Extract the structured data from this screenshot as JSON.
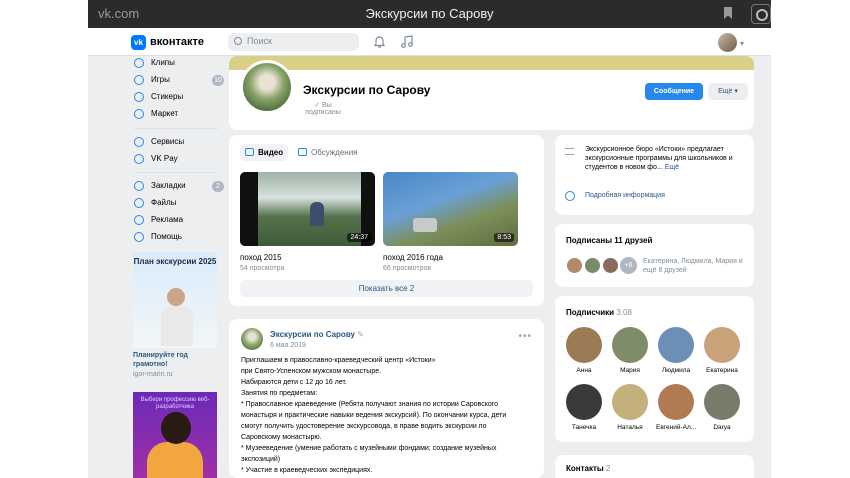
{
  "browser": {
    "url": "vk.com",
    "title": "Экскурсии по Сарову"
  },
  "header": {
    "logo_letters": "vk",
    "logo_text": "вконтакте",
    "search_placeholder": "Поиск"
  },
  "sidebar": {
    "items": [
      {
        "label": "Клипы",
        "icon": "clips-icon"
      },
      {
        "label": "Игры",
        "icon": "games-icon",
        "count": "10"
      },
      {
        "label": "Стикеры",
        "icon": "stickers-icon"
      },
      {
        "label": "Маркет",
        "icon": "market-icon"
      },
      {
        "label": "Сервисы",
        "icon": "services-icon"
      },
      {
        "label": "VK Pay",
        "icon": "vkpay-icon"
      },
      {
        "label": "Закладки",
        "icon": "bookmarks-icon",
        "count": "2"
      },
      {
        "label": "Файлы",
        "icon": "files-icon"
      },
      {
        "label": "Реклама",
        "icon": "ads-icon"
      },
      {
        "label": "Помощь",
        "icon": "help-icon"
      }
    ],
    "ad1": {
      "title": "План экскурсии 2025",
      "caption": "Планируйте год грамотно!",
      "domain": "igor-marin.ru"
    },
    "ad2": {
      "title": "Выбери профессию веб-разработчика"
    }
  },
  "group": {
    "name": "Экскурсии по Сарову",
    "subscribed_label": "Вы подписаны",
    "message_button": "Сообщение",
    "more_button": "Ещё"
  },
  "videos": {
    "tabs": [
      "Видео",
      "Обсуждения"
    ],
    "items": [
      {
        "title": "поход 2015",
        "views": "54 просмотра",
        "duration": "24:37"
      },
      {
        "title": "поход 2016 года",
        "views": "66 просмотров",
        "duration": "8:53"
      }
    ],
    "show_all": "Показать все 2"
  },
  "post": {
    "author": "Экскурсии по Сарову",
    "date": "6 мая 2019",
    "lines": [
      "Приглашаем в православно-краеведческий центр «Истоки»",
      "при Свято-Успенском мужском монастыре.",
      "Набираются дети с 12 до 16 лет.",
      "Занятия по предметам:",
      "* Православное краеведение (Ребята получают знания по истории Саровского",
      "монастыря и практические навыки ведения экскурсий). По окончании курса, дети",
      "смогут получить удостоверение экскурсовода, в праве водить экскурсии по",
      "Саровскому монастырю.",
      "* Музееведение (умение работать с музейными фондами; создание музейных",
      "экспозиций)",
      "* Участие в краеведческих экспедициях."
    ]
  },
  "about": {
    "text": "Экскурсионное бюро «Истоки» предлагает экскурсионные программы для школьников и студентов в новом фо...",
    "more": "Ещё",
    "link": "Подробная информация"
  },
  "friends": {
    "title": "Подписаны 11 друзей",
    "plus": "+8",
    "text": "Екатерина, Людмила, Мария и ещё 8 друзей"
  },
  "subscribers": {
    "title": "Подписчики",
    "count": "3.08",
    "people": [
      {
        "name": "Анна",
        "color": "#9b7b55"
      },
      {
        "name": "Мария",
        "color": "#7f8c6a"
      },
      {
        "name": "Людмила",
        "color": "#6c8fb5"
      },
      {
        "name": "Екатерина",
        "color": "#c9a27a"
      },
      {
        "name": "Танечка",
        "color": "#3a3a3a"
      },
      {
        "name": "Наталья",
        "color": "#c4b07a"
      },
      {
        "name": "Евгений-Ал...",
        "color": "#b07a52"
      },
      {
        "name": "Darya",
        "color": "#7a7a6a"
      }
    ]
  },
  "contacts": {
    "title": "Контакты",
    "count": "2"
  },
  "colors": {
    "accent": "#2688eb",
    "cover_band": "#d9cf87",
    "link": "#2a5885"
  }
}
